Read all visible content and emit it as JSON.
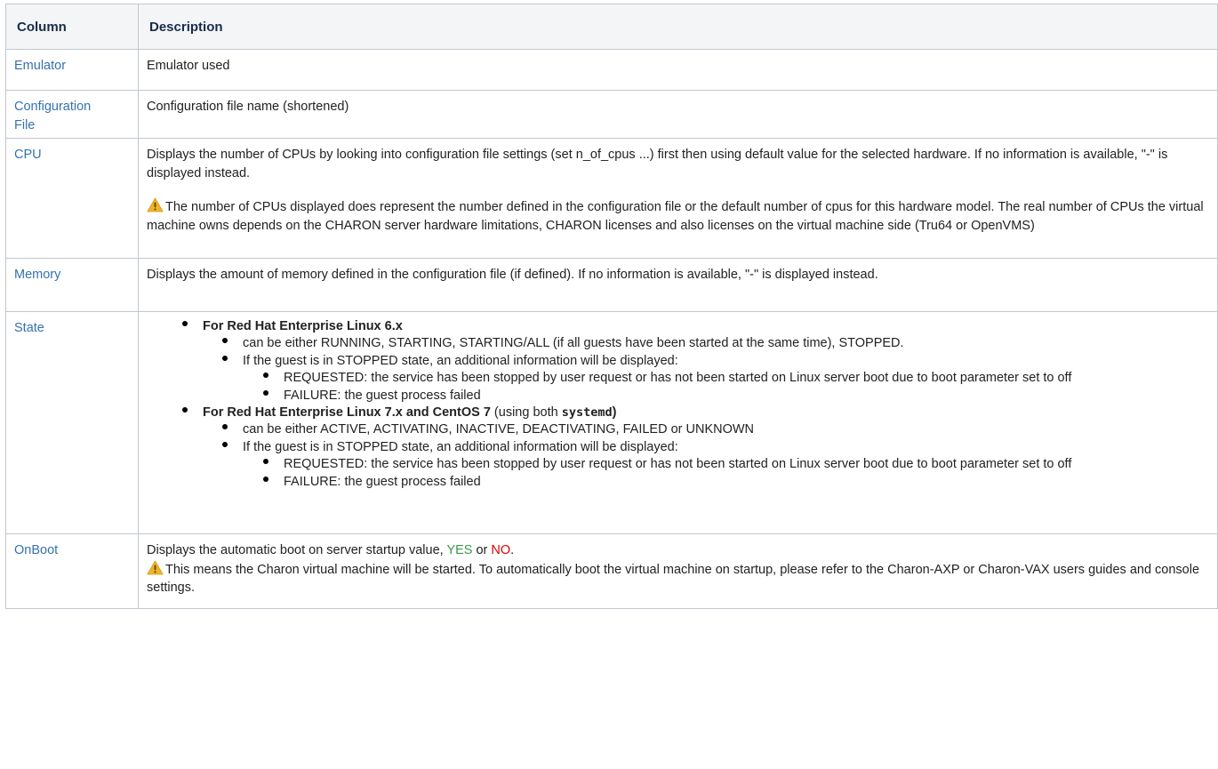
{
  "table": {
    "headers": [
      "Column",
      "Description"
    ],
    "emulator": {
      "name": "Emulator",
      "desc": "Emulator used"
    },
    "config": {
      "name1": "Configuration",
      "name2": "File",
      "desc": "Configuration file name (shortened)"
    },
    "cpu": {
      "name": "CPU",
      "desc": "Displays the number of CPUs by looking into configuration file settings (set n_of_cpus ...) first then using default value for the selected hardware. If no information is available, \"-\" is displayed instead.",
      "warning": "The number of CPUs displayed does represent the number defined in the configuration file or the default number of cpus for this hardware model. The real number of CPUs the virtual machine owns depends on the CHARON server hardware limitations, CHARON licenses and also licenses on the virtual machine side (Tru64 or OpenVMS)"
    },
    "memory": {
      "name": "Memory",
      "desc": "Displays the amount of memory defined in the configuration file (if defined). If no information is available, \"-\" is displayed instead."
    },
    "state": {
      "name": "State",
      "rhel6": {
        "title": "For Red Hat Enterprise Linux 6.x",
        "states": "can be either RUNNING, STARTING, STARTING/ALL (if all guests have been started at the same time), STOPPED.",
        "stopped": "If the guest is in STOPPED state, an additional information will be displayed:",
        "requested": "REQUESTED: the service has been stopped by user request or has not been started on Linux server boot due to boot parameter set to off",
        "failure": "FAILURE: the guest process failed"
      },
      "rhel7": {
        "title": "For Red Hat Enterprise Linux 7.x and CentOS 7",
        "using": " (using both ",
        "systemd": "systemd",
        "close": ")",
        "states": "can be either ACTIVE, ACTIVATING, INACTIVE, DEACTIVATING, FAILED or UNKNOWN",
        "stopped": "If the guest is in STOPPED state, an additional information will be displayed:",
        "requested": "REQUESTED: the service has been stopped by user request or has not been started on Linux server boot due to boot parameter set to off",
        "failure": "FAILURE: the guest process failed"
      }
    },
    "onboot": {
      "name": "OnBoot",
      "desc_pre": "Displays the automatic boot on server startup value, ",
      "yes": "YES",
      "or": " or ",
      "no": "NO",
      "period": ".",
      "warning": "This means the Charon virtual machine will be started. To automatically boot the virtual machine on startup, please refer to the Charon-AXP or Charon-VAX users guides and console settings."
    }
  },
  "colors": {
    "link": "#3572b0",
    "yes": "#3b9a4b",
    "no": "#e00000",
    "warning": "#f0b429",
    "header_bg": "#f4f5f7"
  },
  "icons": {
    "warning": "warning-icon",
    "bullet": "bullet-icon"
  }
}
